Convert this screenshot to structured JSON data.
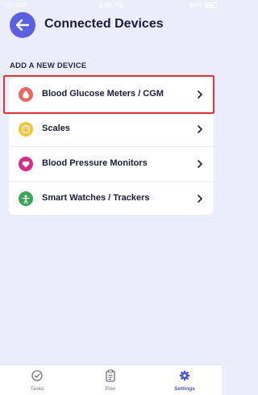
{
  "status_bar": {
    "carrier": "No SIM",
    "time": "2:58 PM",
    "battery": "94%"
  },
  "header": {
    "title": "Connected Devices"
  },
  "section": {
    "label": "ADD A NEW DEVICE"
  },
  "devices": [
    {
      "label": "Blood Glucose Meters / CGM",
      "icon": "blood-drop-icon",
      "color": "#e8675f"
    },
    {
      "label": "Scales",
      "icon": "scale-icon",
      "color": "#f4c33a"
    },
    {
      "label": "Blood Pressure Monitors",
      "icon": "heart-icon",
      "color": "#d62d86"
    },
    {
      "label": "Smart Watches / Trackers",
      "icon": "person-icon",
      "color": "#3aa554"
    }
  ],
  "tabs": [
    {
      "label": "Tasks",
      "icon": "check-circle-icon",
      "active": false
    },
    {
      "label": "Plan",
      "icon": "clipboard-icon",
      "active": false
    },
    {
      "label": "Settings",
      "icon": "gear-icon",
      "active": true
    }
  ],
  "colors": {
    "accent": "#5b5fe0",
    "background": "#ecedfb",
    "highlight": "#e0333d",
    "active_tab": "#4f54d9"
  }
}
